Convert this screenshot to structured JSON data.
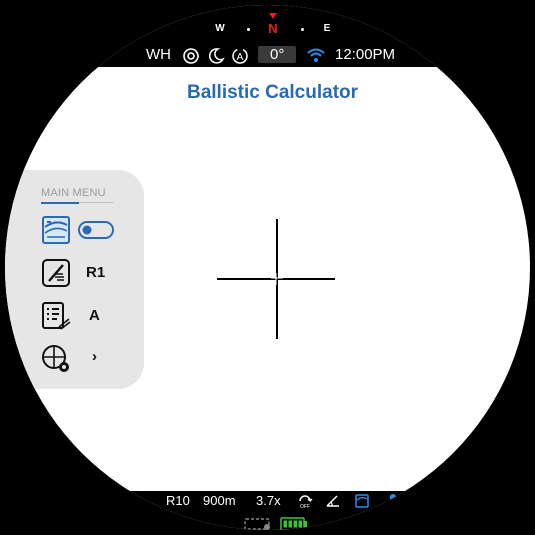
{
  "compass": {
    "w": "W",
    "n": "N",
    "e": "E"
  },
  "status": {
    "mode": "WH",
    "angle": "0°",
    "time": "12:00PM"
  },
  "title": "Ballistic Calculator",
  "menu": {
    "header": "MAIN MENU",
    "items": [
      {
        "icon": "ballistic-calculator-icon",
        "value": "",
        "control": "toggle-switch-on"
      },
      {
        "icon": "rifle-profile-icon",
        "value": "R1"
      },
      {
        "icon": "ammo-list-icon",
        "value": "A"
      },
      {
        "icon": "reticle-settings-icon",
        "value": "›"
      }
    ]
  },
  "bottom": {
    "reticle": "R10",
    "distance": "900m",
    "zoom": "3.7x"
  },
  "colors": {
    "accent": "#2a6ab5",
    "north": "#e8201a",
    "battery": "#3ec23e"
  }
}
